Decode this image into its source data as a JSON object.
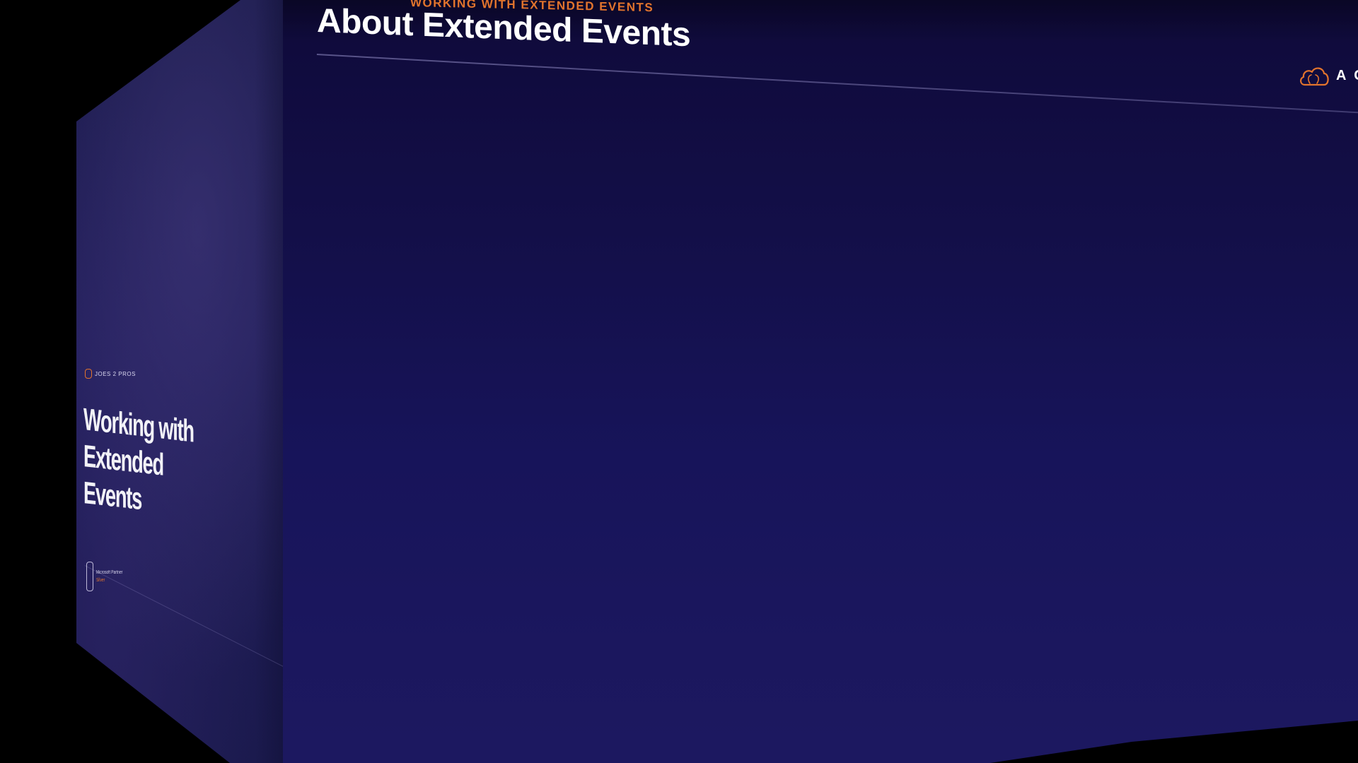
{
  "left_slide": {
    "brand": "JOES 2 PROS",
    "title": "Working with Extended Events",
    "footer_logo_line1": "Microsoft Partner",
    "footer_logo_line2": "Silver"
  },
  "main_slide": {
    "kicker": "WORKING WITH EXTENDED EVENTS",
    "title": "About Extended Events",
    "brand_partial": "A C",
    "brand_icon": "cloud-icon"
  },
  "colors": {
    "accent": "#e2742d",
    "title": "#ffffff",
    "slide_bg_top": "#0f0a3a",
    "slide_bg_bottom": "#1c1860",
    "backdrop": "#000000"
  }
}
